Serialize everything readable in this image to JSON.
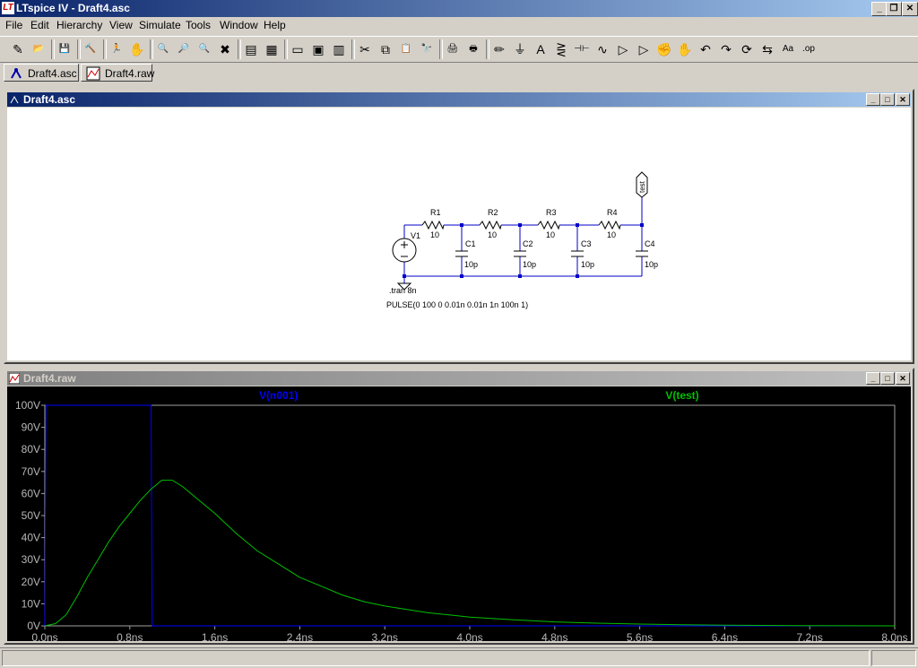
{
  "window": {
    "title": "LTspice IV - Draft4.asc",
    "app_icon": "ltspice-icon"
  },
  "menu": [
    "File",
    "Edit",
    "Hierarchy",
    "View",
    "Simulate",
    "Tools",
    "Window",
    "Help"
  ],
  "toolbar_icons": [
    "new-schematic-icon",
    "open-icon",
    "save-icon",
    "control-panel-icon",
    "run-icon",
    "halt-icon",
    "zoom-in-icon",
    "zoom-pan-icon",
    "zoom-out-icon",
    "zoom-cancel-icon",
    "autorange-icon",
    "add-trace-icon",
    "tile-vertical-icon",
    "cascade-icon",
    "tile-horizontal-icon",
    "cut-icon",
    "copy-icon",
    "paste-icon",
    "find-icon",
    "print-setup-icon",
    "print-icon",
    "wire-icon",
    "ground-icon",
    "label-icon",
    "resistor-icon",
    "capacitor-icon",
    "inductor-icon",
    "diode-icon",
    "component-icon",
    "move-icon",
    "drag-icon",
    "undo-icon",
    "redo-icon",
    "rotate-icon",
    "mirror-icon",
    "text-icon",
    "spice-directive-icon"
  ],
  "toolbar_glyphs": [
    "✎",
    "📂",
    "💾",
    "🔨",
    "🏃",
    "✋",
    "🔍",
    "🔎",
    "🔍",
    "✖",
    "▤",
    "▦",
    "▭",
    "▣",
    "▥",
    "✂",
    "⧉",
    "📋",
    "🔭",
    "🖨",
    "🖶",
    "✏",
    "⏚",
    "A",
    "⋛",
    "⊣⊢",
    "∿",
    "▷",
    "▷",
    "✊",
    "✋",
    "↶",
    "↷",
    "⟳",
    "⇆",
    "Aa",
    ".op"
  ],
  "tabs": [
    {
      "label": "Draft4.asc",
      "icon": "schematic-tab-icon"
    },
    {
      "label": "Draft4.raw",
      "icon": "waveform-tab-icon"
    }
  ],
  "schematic": {
    "title": "Draft4.asc",
    "components": {
      "v1": "V1",
      "r1": "R1",
      "r1v": "10",
      "r2": "R2",
      "r2v": "10",
      "r3": "R3",
      "r3v": "10",
      "r4": "R4",
      "r4v": "10",
      "c1": "C1",
      "c1v": "10p",
      "c2": "C2",
      "c2v": "10p",
      "c3": "C3",
      "c3v": "10p",
      "c4": "C4",
      "c4v": "10p",
      "net_label": "test"
    },
    "directives": {
      "tran": ".tran 8n",
      "pulse": "PULSE(0 100 0 0.01n 0.01n 1n 100n 1)"
    }
  },
  "waveform": {
    "title": "Draft4.raw",
    "colors": {
      "bg": "#000000",
      "grid": "#a0a0a0",
      "n001": "#0000ff",
      "test": "#00c000",
      "axis_text": "#b8b8b8"
    }
  },
  "chart_data": {
    "type": "line",
    "title": "",
    "xlabel": "",
    "ylabel": "",
    "xlim": [
      0,
      8
    ],
    "ylim": [
      0,
      100
    ],
    "x_ticks": [
      "0.0ns",
      "0.8ns",
      "1.6ns",
      "2.4ns",
      "3.2ns",
      "4.0ns",
      "4.8ns",
      "5.6ns",
      "6.4ns",
      "7.2ns",
      "8.0ns"
    ],
    "y_ticks": [
      "0V",
      "10V",
      "20V",
      "30V",
      "40V",
      "50V",
      "60V",
      "70V",
      "80V",
      "90V",
      "100V"
    ],
    "legend": "top",
    "series": [
      {
        "name": "V(n001)",
        "x": [
          0,
          0.01,
          1.0,
          1.01,
          8.0
        ],
        "y": [
          0,
          100,
          100,
          0,
          0
        ]
      },
      {
        "name": "V(test)",
        "x": [
          0,
          0.1,
          0.2,
          0.3,
          0.4,
          0.5,
          0.6,
          0.7,
          0.8,
          0.9,
          1.0,
          1.1,
          1.2,
          1.3,
          1.4,
          1.6,
          1.8,
          2.0,
          2.2,
          2.4,
          2.6,
          2.8,
          3.0,
          3.2,
          3.6,
          4.0,
          4.4,
          4.8,
          5.2,
          5.6,
          6.0,
          6.4,
          7.2,
          8.0
        ],
        "y": [
          0,
          1,
          5,
          13,
          22,
          30,
          38,
          45,
          51,
          57,
          62,
          66,
          66,
          63,
          59,
          51,
          42,
          34,
          28,
          22,
          18,
          14,
          11,
          9,
          6,
          4,
          2.8,
          1.8,
          1.2,
          0.8,
          0.5,
          0.3,
          0.1,
          0
        ]
      }
    ]
  }
}
